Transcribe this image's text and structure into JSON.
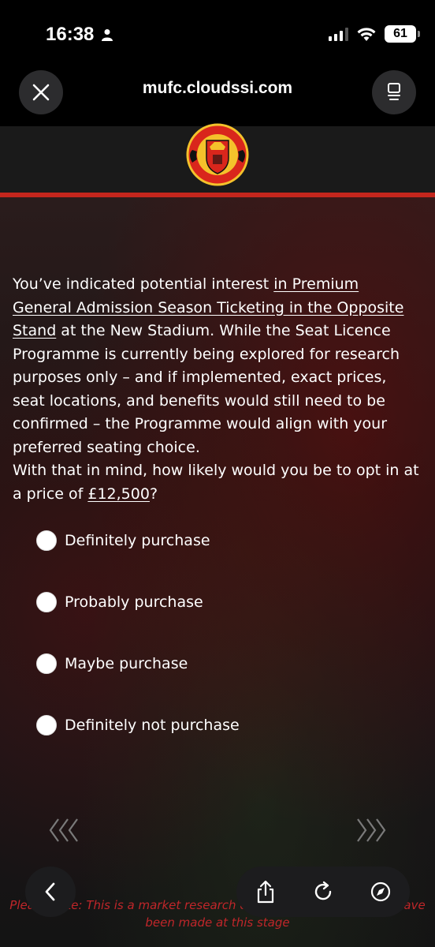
{
  "status_bar": {
    "time": "16:38",
    "battery": "61"
  },
  "browser": {
    "url": "mufc.cloudssi.com"
  },
  "header": {
    "logo": "Manchester United crest"
  },
  "question": {
    "intro": "You’ve indicated potential interest ",
    "link1": "in Premium General Admission Season Ticketing in the Opposite Stand",
    "middle": " at the New Stadium. While the Seat Licence Programme is currently being explored for research purposes only – and if implemented, exact prices, seat locations, and benefits would still need to be confirmed – the Programme would align with your preferred seating choice.",
    "prompt": "With that in mind, how likely would you be to opt in at a price of ",
    "price": "£12,500",
    "end": "?"
  },
  "options": [
    {
      "label": "Definitely purchase"
    },
    {
      "label": "Probably purchase"
    },
    {
      "label": "Maybe purchase"
    },
    {
      "label": "Definitely not purchase"
    }
  ],
  "nav": {
    "prev": "«‹",
    "next": "›»"
  },
  "note": {
    "line1": "Please note: This is a market research exercise and no decisions have",
    "line2": "been made at this stage"
  },
  "colors": {
    "accent_red": "#c4261d",
    "note_red": "#c0262a"
  }
}
